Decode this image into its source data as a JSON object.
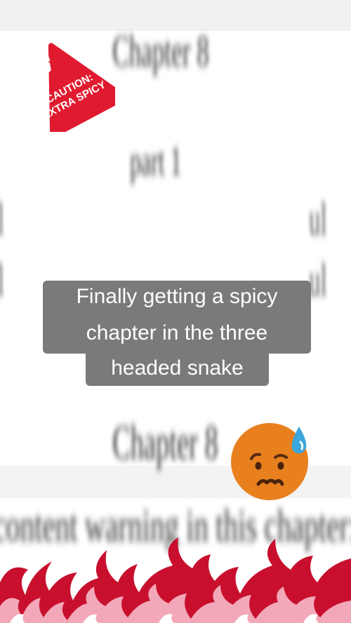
{
  "sticker": {
    "line1": "CAUTION:",
    "line2": "EXTRA SPICY",
    "icon": "hot-sauce-bottle"
  },
  "caption": {
    "line1": "Finally getting a spicy",
    "line2": "chapter in the three",
    "line3": "headed snake"
  },
  "blurred_background": {
    "line1": "Chapter 8",
    "line2": "part 1",
    "line3": "Chapter 8",
    "line4": "content warning in this chapter: i",
    "line5": "content"
  },
  "emoji": "anxious-face-with-sweat",
  "colors": {
    "sticker_red": "#e01b2f",
    "caption_bg": "#7a7a7a",
    "flame_dark": "#c8102e",
    "flame_light": "#f2a8b8",
    "emoji_face": "#e8801e"
  }
}
